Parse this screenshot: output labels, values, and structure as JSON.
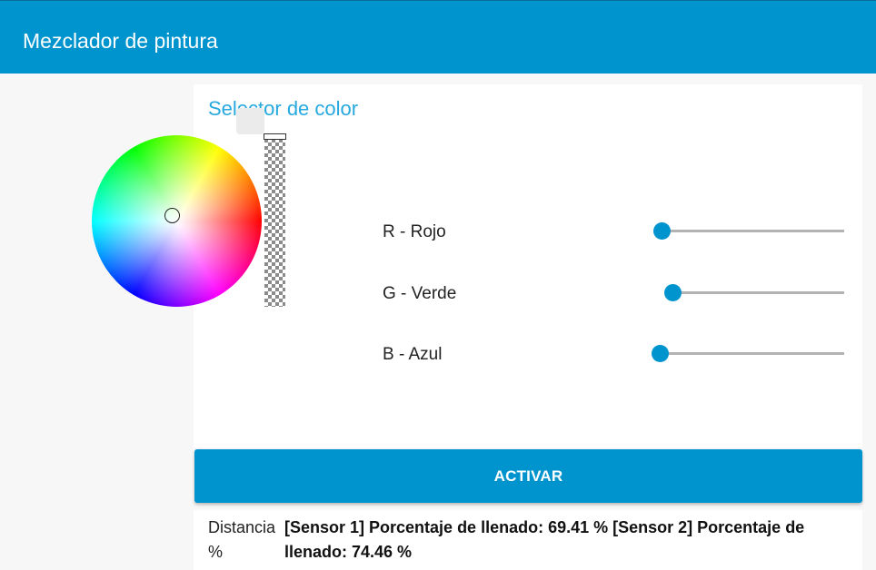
{
  "app": {
    "title": "Mezclador de pintura",
    "accent_color": "#0094ce"
  },
  "color_picker": {
    "title": "Selector de color",
    "preview_color": "#ebebeb",
    "sliders": [
      {
        "label": "R - Rojo",
        "value": 0
      },
      {
        "label": "G - Verde",
        "value": 0
      },
      {
        "label": "B - Azul",
        "value": 0
      }
    ]
  },
  "actions": {
    "activate_label": "ACTIVAR"
  },
  "output": {
    "label": "Distancia %",
    "value": "[Sensor 1] Porcentaje de llenado: 69.41 % [Sensor 2] Porcentaje de llenado: 74.46 %"
  }
}
